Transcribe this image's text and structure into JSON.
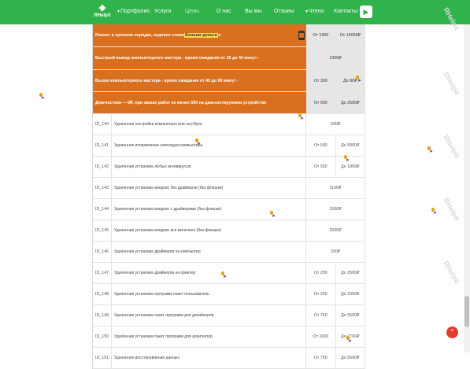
{
  "nav": {
    "logo_mark": "◈",
    "logo_text": "RHelpit",
    "items": [
      {
        "label": "Портфолио",
        "has_caret": true
      },
      {
        "label": "Услуги",
        "has_caret": false
      },
      {
        "label": "Цены",
        "has_caret": false
      },
      {
        "label": "О нас",
        "has_caret": false
      },
      {
        "label": "Вы мы",
        "has_caret": false
      },
      {
        "label": "Отзывы",
        "has_caret": false
      },
      {
        "label": "Чтено",
        "has_caret": true
      },
      {
        "label": "Контакты",
        "has_caret": false
      }
    ],
    "caret_glyph": "▾",
    "play_icon": "▶"
  },
  "orange_rows": [
    {
      "text_before": "Ремонт в срочном порядке, кодовое слово ",
      "highlight": "Больше деньги",
      "text_after": " ►",
      "price_a": "От 1400",
      "price_b": "От 14000₽",
      "split": true
    },
    {
      "text_before": "Быстрый вывод компьютерного мастера - время ожидания от 15 до 40 минут - ",
      "highlight": "",
      "text_after": "",
      "price_a": "1000₽",
      "price_b": "",
      "split": false
    },
    {
      "text_before": "Вызов компьютерного мастера - время ожидания от 40 до 90 минут - ",
      "highlight": "",
      "text_after": "",
      "price_a": "От 300",
      "price_b": "До 8б₽",
      "split": true
    },
    {
      "text_before": "Диагностика — 0₽, при заказе работ не менее 500 на диагностируемом устройстве",
      "highlight": "",
      "text_after": "",
      "price_a": "От 500",
      "price_b": "До 2500₽",
      "split": true
    }
  ],
  "rows": [
    {
      "id": "ID_140",
      "name": "Удаленная настройка компьютера или ноутбука",
      "price_a": "600₽",
      "price_b": "",
      "split": false
    },
    {
      "id": "ID_141",
      "name": "Удаленное исправление неполадок компьютера",
      "price_a": "От 500",
      "price_b": "До 5000₽",
      "split": true
    },
    {
      "id": "ID_142",
      "name": "Удаленная установка любых антивирусов",
      "price_a": "От 550",
      "price_b": "До 1850₽",
      "split": true
    },
    {
      "id": "ID_143",
      "name": "Удаленная установка виндовс без драйверов (без флешки)",
      "price_a": "1100₽",
      "price_b": "",
      "split": false
    },
    {
      "id": "ID_144",
      "name": "Удаленная установка виндовс с драйверами (без флешки)",
      "price_a": "1500₽",
      "price_b": "",
      "split": false
    },
    {
      "id": "ID_145",
      "name": "Удаленная установка виндовс все включено (без флешки)",
      "price_a": "2500₽",
      "price_b": "",
      "split": false
    },
    {
      "id": "ID_146",
      "name": "Удаленная установка драйверов на компьютер",
      "price_a": "300₽",
      "price_b": "",
      "split": false
    },
    {
      "id": "ID_147",
      "name": "Удаленная установка драйверов на принтер",
      "price_a": "От 250",
      "price_b": "До 2500₽",
      "split": true
    },
    {
      "id": "ID_148",
      "name": "Удаленная установка программ пакет пользователь",
      "price_a": "От 250",
      "price_b": "До 1050₽",
      "split": true
    },
    {
      "id": "ID_149",
      "name": "Удаленная установка пакет программ для дизайнеров",
      "price_a": "От 750",
      "price_b": "До 5500₽",
      "split": true
    },
    {
      "id": "ID_150",
      "name": "Удаленная установка пакет программ для архитектор",
      "price_a": "От 1000",
      "price_b": "До 7700₽",
      "split": true
    },
    {
      "id": "ID_151",
      "name": "Удаленное восстановление данных",
      "price_a": "От 750",
      "price_b": "До 6500₽",
      "split": true
    }
  ],
  "watermark_text": "RHelpit",
  "scroll_up_icon": "⌃",
  "colors": {
    "brand_green": "#2fb34a",
    "accent_orange": "#d9701f",
    "highlight_yellow": "#ffd84d",
    "scroll_up_red": "#e23b2e"
  }
}
